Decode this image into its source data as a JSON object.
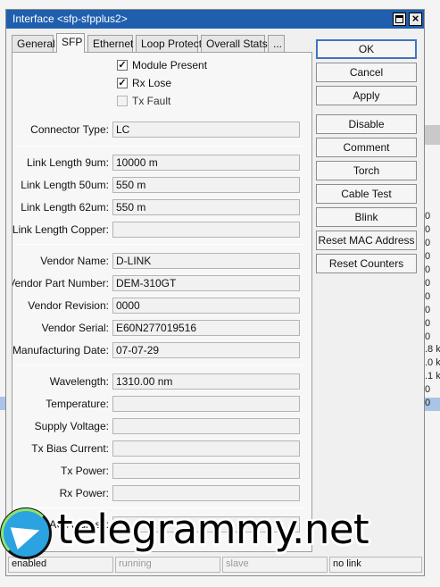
{
  "window": {
    "title": "Interface <sfp-sfpplus2>"
  },
  "tabs": [
    {
      "label": "General"
    },
    {
      "label": "SFP"
    },
    {
      "label": "Ethernet"
    },
    {
      "label": "Loop Protect"
    },
    {
      "label": "Overall Stats"
    },
    {
      "label": "..."
    }
  ],
  "checkboxes": {
    "module_present": {
      "label": "Module Present",
      "checked": true,
      "mark": "✓"
    },
    "rx_lose": {
      "label": "Rx Lose",
      "checked": true,
      "mark": "✓"
    },
    "tx_fault": {
      "label": "Tx Fault",
      "checked": false
    }
  },
  "fields": {
    "connector_type": {
      "label": "Connector Type:",
      "value": "LC"
    },
    "link_length_9um": {
      "label": "Link Length 9um:",
      "value": "10000 m"
    },
    "link_length_50um": {
      "label": "Link Length 50um:",
      "value": "550 m"
    },
    "link_length_62um": {
      "label": "Link Length 62um:",
      "value": "550 m"
    },
    "link_length_copper": {
      "label": "Link Length Copper:",
      "value": ""
    },
    "vendor_name": {
      "label": "Vendor Name:",
      "value": "D-LINK"
    },
    "vendor_part_number": {
      "label": "Vendor Part Number:",
      "value": "DEM-310GT"
    },
    "vendor_revision": {
      "label": "Vendor Revision:",
      "value": "0000"
    },
    "vendor_serial": {
      "label": "Vendor Serial:",
      "value": "E60N277019516"
    },
    "manufacturing_date": {
      "label": "Manufacturing Date:",
      "value": "07-07-29"
    },
    "wavelength": {
      "label": "Wavelength:",
      "value": "1310.00 nm"
    },
    "temperature": {
      "label": "Temperature:",
      "value": ""
    },
    "supply_voltage": {
      "label": "Supply Voltage:",
      "value": ""
    },
    "tx_bias_current": {
      "label": "Tx Bias Current:",
      "value": ""
    },
    "tx_power": {
      "label": "Tx Power:",
      "value": ""
    },
    "rx_power": {
      "label": "Rx Power:",
      "value": ""
    },
    "mac_address": {
      "label": "MAC Address:",
      "value": ""
    }
  },
  "buttons": {
    "ok": "OK",
    "cancel": "Cancel",
    "apply": "Apply",
    "disable": "Disable",
    "comment": "Comment",
    "torch": "Torch",
    "cable_test": "Cable Test",
    "blink": "Blink",
    "reset_mac": "Reset MAC Address",
    "reset_counters": "Reset Counters"
  },
  "status": {
    "enabled": "enabled",
    "running": "running",
    "slave": "slave",
    "link": "no link"
  },
  "background_column": [
    "0",
    "0",
    "0",
    "0",
    "0",
    "0",
    "0",
    "0",
    "0",
    "0",
    ".8 k",
    ".0 k",
    ".1 k",
    "0",
    "0"
  ],
  "watermark": {
    "text": "telegrammy.net",
    "logo_icon": "telegram-logo-icon"
  },
  "colors": {
    "titlebar": "#1f5fae",
    "ok_border": "#3f75c2",
    "selection": "#a9c4e6"
  }
}
